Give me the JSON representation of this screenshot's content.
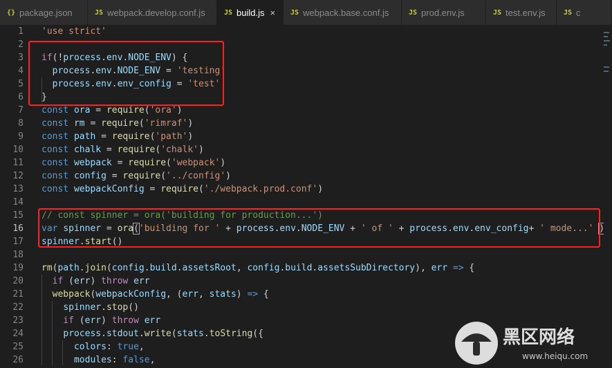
{
  "tabs": [
    {
      "icon": "{}",
      "label": "package.json",
      "active": false
    },
    {
      "icon": "JS",
      "label": "webpack.develop.conf.js",
      "active": false
    },
    {
      "icon": "JS",
      "label": "build.js",
      "active": true
    },
    {
      "icon": "JS",
      "label": "webpack.base.conf.js",
      "active": false
    },
    {
      "icon": "JS",
      "label": "prod.env.js",
      "active": false
    },
    {
      "icon": "JS",
      "label": "test.env.js",
      "active": false
    },
    {
      "icon": "JS",
      "label": "c",
      "active": false
    }
  ],
  "close_glyph": "×",
  "current_line": 16,
  "line_numbers": [
    "1",
    "2",
    "3",
    "4",
    "5",
    "6",
    "7",
    "8",
    "9",
    "10",
    "11",
    "12",
    "13",
    "14",
    "15",
    "16",
    "17",
    "18",
    "19",
    "20",
    "21",
    "22",
    "23",
    "24",
    "25",
    "26"
  ],
  "lines": [
    [
      [
        "str",
        "'use strict'"
      ]
    ],
    [],
    [
      [
        "ctl",
        "if"
      ],
      [
        "t",
        "(!"
      ],
      [
        "var",
        "process"
      ],
      [
        "t",
        "."
      ],
      [
        "var",
        "env"
      ],
      [
        "t",
        "."
      ],
      [
        "var",
        "NODE_ENV"
      ],
      [
        "t",
        ") {"
      ]
    ],
    [
      [
        "t",
        "  "
      ],
      [
        "var",
        "process"
      ],
      [
        "t",
        "."
      ],
      [
        "var",
        "env"
      ],
      [
        "t",
        "."
      ],
      [
        "var",
        "NODE_ENV"
      ],
      [
        "t",
        " = "
      ],
      [
        "str",
        "'testing'"
      ]
    ],
    [
      [
        "t",
        "  "
      ],
      [
        "var",
        "process"
      ],
      [
        "t",
        "."
      ],
      [
        "var",
        "env"
      ],
      [
        "t",
        "."
      ],
      [
        "var",
        "env_config"
      ],
      [
        "t",
        " = "
      ],
      [
        "str",
        "'test'"
      ]
    ],
    [
      [
        "t",
        "}"
      ]
    ],
    [
      [
        "kw",
        "const"
      ],
      [
        "t",
        " "
      ],
      [
        "var",
        "ora"
      ],
      [
        "t",
        " = "
      ],
      [
        "fn",
        "require"
      ],
      [
        "t",
        "("
      ],
      [
        "str",
        "'ora'"
      ],
      [
        "t",
        ")"
      ]
    ],
    [
      [
        "kw",
        "const"
      ],
      [
        "t",
        " "
      ],
      [
        "var",
        "rm"
      ],
      [
        "t",
        " = "
      ],
      [
        "fn",
        "require"
      ],
      [
        "t",
        "("
      ],
      [
        "str",
        "'rimraf'"
      ],
      [
        "t",
        ")"
      ]
    ],
    [
      [
        "kw",
        "const"
      ],
      [
        "t",
        " "
      ],
      [
        "var",
        "path"
      ],
      [
        "t",
        " = "
      ],
      [
        "fn",
        "require"
      ],
      [
        "t",
        "("
      ],
      [
        "str",
        "'path'"
      ],
      [
        "t",
        ")"
      ]
    ],
    [
      [
        "kw",
        "const"
      ],
      [
        "t",
        " "
      ],
      [
        "var",
        "chalk"
      ],
      [
        "t",
        " = "
      ],
      [
        "fn",
        "require"
      ],
      [
        "t",
        "("
      ],
      [
        "str",
        "'chalk'"
      ],
      [
        "t",
        ")"
      ]
    ],
    [
      [
        "kw",
        "const"
      ],
      [
        "t",
        " "
      ],
      [
        "var",
        "webpack"
      ],
      [
        "t",
        " = "
      ],
      [
        "fn",
        "require"
      ],
      [
        "t",
        "("
      ],
      [
        "str",
        "'webpack'"
      ],
      [
        "t",
        ")"
      ]
    ],
    [
      [
        "kw",
        "const"
      ],
      [
        "t",
        " "
      ],
      [
        "var",
        "config"
      ],
      [
        "t",
        " = "
      ],
      [
        "fn",
        "require"
      ],
      [
        "t",
        "("
      ],
      [
        "str",
        "'../config'"
      ],
      [
        "t",
        ")"
      ]
    ],
    [
      [
        "kw",
        "const"
      ],
      [
        "t",
        " "
      ],
      [
        "var",
        "webpackConfig"
      ],
      [
        "t",
        " = "
      ],
      [
        "fn",
        "require"
      ],
      [
        "t",
        "("
      ],
      [
        "str",
        "'./webpack.prod.conf'"
      ],
      [
        "t",
        ")"
      ]
    ],
    [],
    [
      [
        "cm",
        "// const spinner = ora('building for production...')"
      ]
    ],
    [
      [
        "kw",
        "var"
      ],
      [
        "t",
        " "
      ],
      [
        "var",
        "spinner"
      ],
      [
        "t",
        " = "
      ],
      [
        "fn",
        "ora"
      ],
      [
        "b",
        "("
      ],
      [
        "str",
        "'building for '"
      ],
      [
        "t",
        " + "
      ],
      [
        "var",
        "process"
      ],
      [
        "t",
        "."
      ],
      [
        "var",
        "env"
      ],
      [
        "t",
        "."
      ],
      [
        "var",
        "NODE_ENV"
      ],
      [
        "t",
        " + "
      ],
      [
        "str",
        "' of '"
      ],
      [
        "t",
        " + "
      ],
      [
        "var",
        "process"
      ],
      [
        "t",
        "."
      ],
      [
        "var",
        "env"
      ],
      [
        "t",
        "."
      ],
      [
        "var",
        "env_config"
      ],
      [
        "t",
        "+ "
      ],
      [
        "str",
        "' mode...'"
      ],
      [
        "t",
        " "
      ],
      [
        "b",
        ")"
      ]
    ],
    [
      [
        "var",
        "spinner"
      ],
      [
        "t",
        "."
      ],
      [
        "fn",
        "start"
      ],
      [
        "t",
        "()"
      ]
    ],
    [],
    [
      [
        "fn",
        "rm"
      ],
      [
        "t",
        "("
      ],
      [
        "var",
        "path"
      ],
      [
        "t",
        "."
      ],
      [
        "fn",
        "join"
      ],
      [
        "t",
        "("
      ],
      [
        "var",
        "config"
      ],
      [
        "t",
        "."
      ],
      [
        "var",
        "build"
      ],
      [
        "t",
        "."
      ],
      [
        "var",
        "assetsRoot"
      ],
      [
        "t",
        ", "
      ],
      [
        "var",
        "config"
      ],
      [
        "t",
        "."
      ],
      [
        "var",
        "build"
      ],
      [
        "t",
        "."
      ],
      [
        "var",
        "assetsSubDirectory"
      ],
      [
        "t",
        "), "
      ],
      [
        "var",
        "err"
      ],
      [
        "t",
        " "
      ],
      [
        "kw",
        "=>"
      ],
      [
        "t",
        " {"
      ]
    ],
    [
      [
        "t",
        "  "
      ],
      [
        "ctl",
        "if"
      ],
      [
        "t",
        " ("
      ],
      [
        "var",
        "err"
      ],
      [
        "t",
        ") "
      ],
      [
        "ctl",
        "throw"
      ],
      [
        "t",
        " "
      ],
      [
        "var",
        "err"
      ]
    ],
    [
      [
        "t",
        "  "
      ],
      [
        "fn",
        "webpack"
      ],
      [
        "t",
        "("
      ],
      [
        "var",
        "webpackConfig"
      ],
      [
        "t",
        ", ("
      ],
      [
        "var",
        "err"
      ],
      [
        "t",
        ", "
      ],
      [
        "var",
        "stats"
      ],
      [
        "t",
        ") "
      ],
      [
        "kw",
        "=>"
      ],
      [
        "t",
        " {"
      ]
    ],
    [
      [
        "t",
        "    "
      ],
      [
        "var",
        "spinner"
      ],
      [
        "t",
        "."
      ],
      [
        "fn",
        "stop"
      ],
      [
        "t",
        "()"
      ]
    ],
    [
      [
        "t",
        "    "
      ],
      [
        "ctl",
        "if"
      ],
      [
        "t",
        " ("
      ],
      [
        "var",
        "err"
      ],
      [
        "t",
        ") "
      ],
      [
        "ctl",
        "throw"
      ],
      [
        "t",
        " "
      ],
      [
        "var",
        "err"
      ]
    ],
    [
      [
        "t",
        "    "
      ],
      [
        "var",
        "process"
      ],
      [
        "t",
        "."
      ],
      [
        "var",
        "stdout"
      ],
      [
        "t",
        "."
      ],
      [
        "fn",
        "write"
      ],
      [
        "t",
        "("
      ],
      [
        "var",
        "stats"
      ],
      [
        "t",
        "."
      ],
      [
        "fn",
        "toString"
      ],
      [
        "t",
        "({"
      ]
    ],
    [
      [
        "t",
        "      "
      ],
      [
        "var",
        "colors"
      ],
      [
        "t",
        ": "
      ],
      [
        "kw",
        "true"
      ],
      [
        "t",
        ","
      ]
    ],
    [
      [
        "t",
        "      "
      ],
      [
        "var",
        "modules"
      ],
      [
        "t",
        ": "
      ],
      [
        "kw",
        "false"
      ],
      [
        "t",
        ","
      ]
    ]
  ],
  "watermark": {
    "title": "黑区网络",
    "url": "www.heiqu.com"
  },
  "colors": {
    "highlight": "#ff1f1f",
    "background": "#1e1e1e"
  }
}
